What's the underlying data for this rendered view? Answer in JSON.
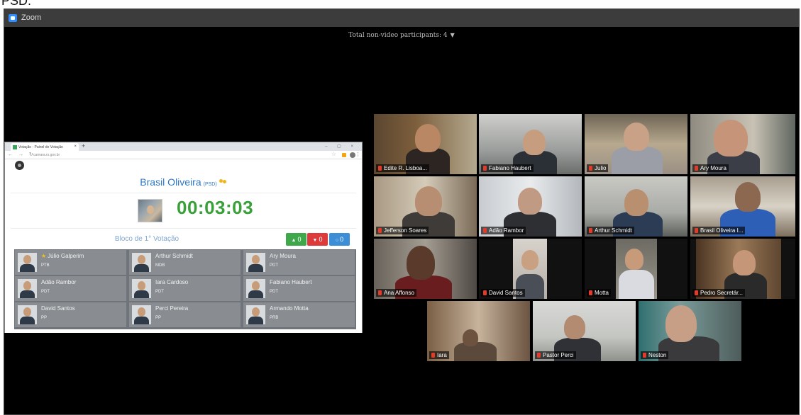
{
  "page": {
    "top_text": "PSD."
  },
  "window": {
    "title": "Zoom"
  },
  "gallery_header": {
    "label": "Total non-video participants: 4"
  },
  "shared_screen": {
    "browser": {
      "tab_title": "Votação - Painel de Votação",
      "url": "camara.rs.gov.br"
    },
    "speaker": {
      "name": "Brasil Oliveira",
      "party": "(PSD)",
      "timer": "00:03:03"
    },
    "bloco_label": "Bloco de 1° Votação",
    "votes": {
      "yes": "0",
      "no": "0",
      "abstain": "0"
    },
    "councillors": [
      {
        "name": "Júlio Galperim",
        "party": "PTB",
        "starred": "★"
      },
      {
        "name": "Arthur Schmidt",
        "party": "MDB",
        "starred": ""
      },
      {
        "name": "Ary Moura",
        "party": "PDT",
        "starred": ""
      },
      {
        "name": "Adão Rambor",
        "party": "PDT",
        "starred": ""
      },
      {
        "name": "Iara Cardoso",
        "party": "PDT",
        "starred": ""
      },
      {
        "name": "Fabiano Haubert",
        "party": "PDT",
        "starred": ""
      },
      {
        "name": "David Santos",
        "party": "PP",
        "starred": ""
      },
      {
        "name": "Perci Pereira",
        "party": "PP",
        "starred": ""
      },
      {
        "name": "Armando Motta",
        "party": "PRB",
        "starred": ""
      }
    ]
  },
  "participants": [
    {
      "name": "Edite R. Lisboa...",
      "active": false
    },
    {
      "name": "Fabiano Haubert",
      "active": false
    },
    {
      "name": "Julio",
      "active": false
    },
    {
      "name": "Ary Moura",
      "active": false
    },
    {
      "name": "Jefferson Soares",
      "active": false
    },
    {
      "name": "Adão Rambor",
      "active": false
    },
    {
      "name": "Arthur Schmidt",
      "active": false
    },
    {
      "name": "Brasil Oliveira I...",
      "active": true
    },
    {
      "name": "Ana Affonso",
      "active": false
    },
    {
      "name": "David Santos",
      "active": false
    },
    {
      "name": "Motta",
      "active": false
    },
    {
      "name": "Pedro Secretár...",
      "active": false
    },
    {
      "name": "Iara",
      "active": false
    },
    {
      "name": "Pastor Perci",
      "active": false
    },
    {
      "name": "Neston",
      "active": false
    }
  ],
  "colors": {
    "accent": "#2f78c4",
    "timer": "#3aa03a",
    "active_speaker_border": "#c9e36b",
    "vote_yes": "#3ea84a",
    "vote_no": "#dd3b3b",
    "vote_abstain": "#3c8fd7"
  },
  "icons": {
    "app": "zoom-logo-icon",
    "dropdown": "chevron-down-icon",
    "mic_muted": "mic-muted-icon",
    "settings": "gear-icon",
    "thumbs_up": "thumbs-up-icon",
    "thumbs_down": "thumbs-down-icon",
    "abstain": "circle-icon",
    "people": "people-icon"
  }
}
